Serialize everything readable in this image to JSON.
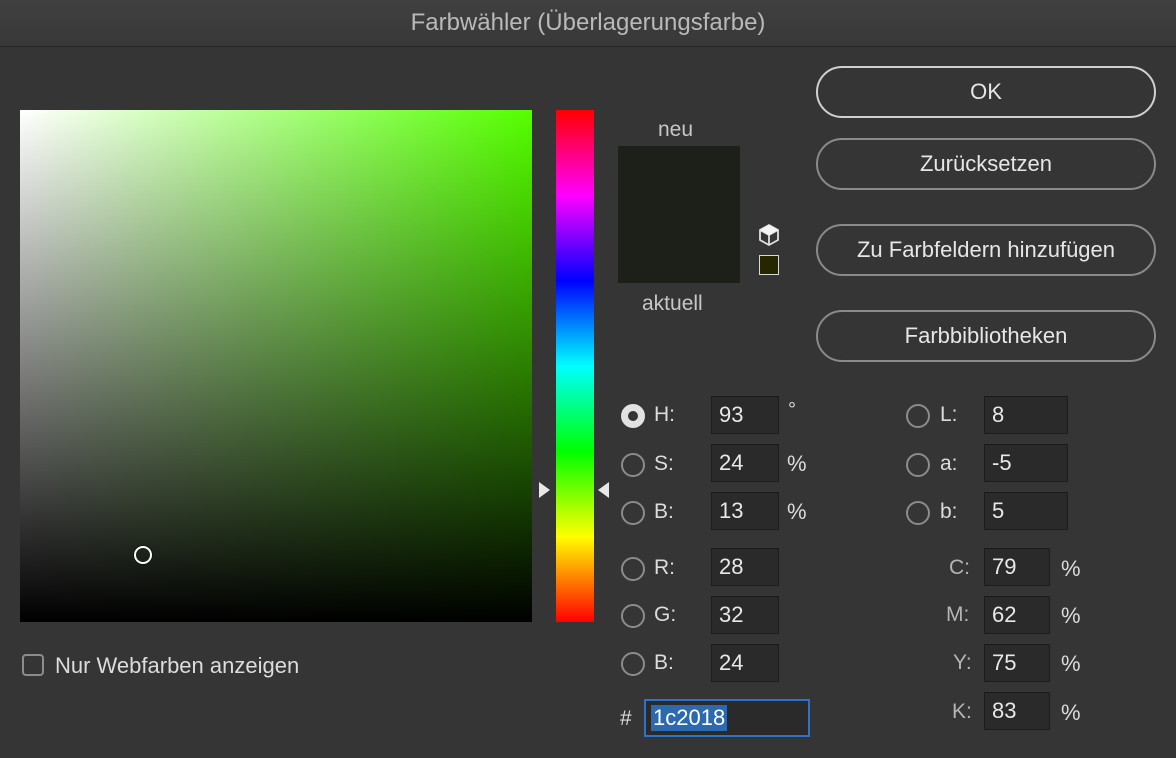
{
  "window": {
    "title": "Farbwähler (Überlagerungsfarbe)"
  },
  "colors": {
    "current": "#1c2018",
    "web_safe_warning": "#262600",
    "hue_color": "#55ff00",
    "accent": "#2e73c9"
  },
  "picker": {
    "saturation_percent": 24,
    "brightness_percent": 13,
    "hue_degrees": 93
  },
  "swatch": {
    "new_label": "neu",
    "current_label": "aktuell"
  },
  "buttons": {
    "ok": "OK",
    "reset": "Zurücksetzen",
    "add_swatches": "Zu Farbfeldern hinzufügen",
    "libraries": "Farbbibliotheken"
  },
  "hsb": {
    "h": {
      "label": "H:",
      "value": "93",
      "unit": "°"
    },
    "s": {
      "label": "S:",
      "value": "24",
      "unit": "%"
    },
    "b": {
      "label": "B:",
      "value": "13",
      "unit": "%"
    }
  },
  "rgb": {
    "r": {
      "label": "R:",
      "value": "28"
    },
    "g": {
      "label": "G:",
      "value": "32"
    },
    "b": {
      "label": "B:",
      "value": "24"
    }
  },
  "lab": {
    "l": {
      "label": "L:",
      "value": "8"
    },
    "a": {
      "label": "a:",
      "value": "-5"
    },
    "b": {
      "label": "b:",
      "value": "5"
    }
  },
  "cmyk": {
    "c": {
      "label": "C:",
      "value": "79",
      "unit": "%"
    },
    "m": {
      "label": "M:",
      "value": "62",
      "unit": "%"
    },
    "y": {
      "label": "Y:",
      "value": "75",
      "unit": "%"
    },
    "k": {
      "label": "K:",
      "value": "83",
      "unit": "%"
    }
  },
  "hex": {
    "label": "#",
    "value": "1c2018"
  },
  "web_only": {
    "label": "Nur Webfarben anzeigen",
    "checked": false
  },
  "icons": {
    "gamut": "gamut-warning-cube-icon",
    "web_safe": "web-safe-swatch-icon",
    "slider": "hue-slider-arrow-icon"
  }
}
